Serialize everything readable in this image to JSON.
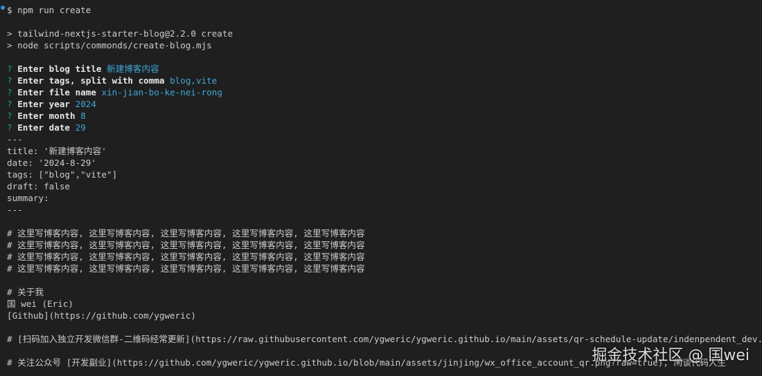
{
  "top_cutoff": "  ~  ~  ~  ~  ~  ~  ~  ~  ~  ~  ~  ~  ~  ~  ~  ~",
  "cmd": {
    "prompt": "$ ",
    "text": "npm run create"
  },
  "output_lines": [
    "> tailwind-nextjs-starter-blog@2.2.0 create",
    "> node scripts/commonds/create-blog.mjs"
  ],
  "questions": [
    {
      "mark": "?",
      "label": "Enter blog title",
      "answer": "新建博客内容"
    },
    {
      "mark": "?",
      "label": "Enter tags, split with comma",
      "answer": "blog,vite"
    },
    {
      "mark": "?",
      "label": "Enter file name",
      "answer": "xin-jian-bo-ke-nei-rong"
    },
    {
      "mark": "?",
      "label": "Enter year",
      "answer": "2024"
    },
    {
      "mark": "?",
      "label": "Enter month",
      "answer": "8"
    },
    {
      "mark": "?",
      "label": "Enter date",
      "answer": "29"
    }
  ],
  "frontmatter": [
    "---",
    "title: '新建博客内容'",
    "date: '2024-8-29'",
    "tags: [\"blog\",\"vite\"]",
    "draft: false",
    "summary:",
    "---"
  ],
  "body1": [
    "# 这里写博客内容, 这里写博客内容, 这里写博客内容, 这里写博客内容, 这里写博客内容",
    "# 这里写博客内容, 这里写博客内容, 这里写博客内容, 这里写博客内容, 这里写博客内容",
    "# 这里写博客内容, 这里写博客内容, 这里写博客内容, 这里写博客内容, 这里写博客内容",
    "# 这里写博客内容, 这里写博客内容, 这里写博客内容, 这里写博客内容, 这里写博客内容"
  ],
  "about": [
    "# 关于我",
    "国 wei (Eric)",
    "[Github](https://github.com/ygweric)"
  ],
  "qr_line": "# [扫码加入独立开发微信群-二维码经常更新](https://raw.githubusercontent.com/ygweric/ygweric.github.io/main/assets/qr-schedule-update/indenpendent_dev.png)",
  "wx_line": "# 关注公众号 [开发副业](https://github.com/ygweric/ygweric.github.io/blob/main/assets/jinjing/wx_office_account_qr.png?raw=true), 闲谈代码人生",
  "watermark": "掘金技术社区 @ 国wei",
  "colors": {
    "background": "#1f1f1f",
    "text": "#cccccc",
    "answer": "#3fa7d6",
    "question_mark": "#22a36b"
  }
}
